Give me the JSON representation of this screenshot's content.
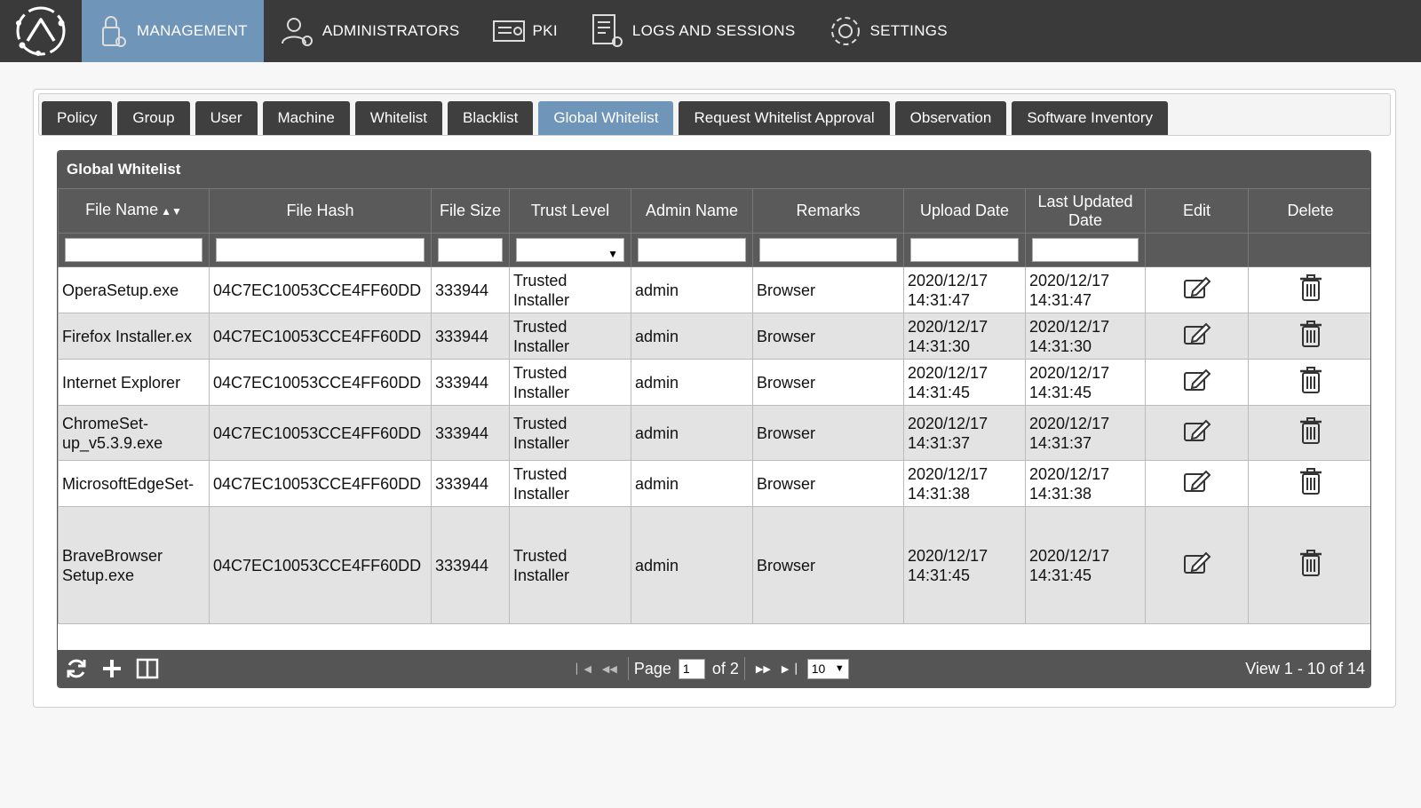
{
  "nav": {
    "items": [
      {
        "label": "MANAGEMENT",
        "icon": "lock-gear-icon",
        "active": true
      },
      {
        "label": "ADMINISTRATORS",
        "icon": "user-gear-icon",
        "active": false
      },
      {
        "label": "PKI",
        "icon": "certificate-icon",
        "active": false
      },
      {
        "label": "LOGS AND SESSIONS",
        "icon": "log-gear-icon",
        "active": false
      },
      {
        "label": "SETTINGS",
        "icon": "gear-icon",
        "active": false
      }
    ]
  },
  "tabs": [
    "Policy",
    "Group",
    "User",
    "Machine",
    "Whitelist",
    "Blacklist",
    "Global Whitelist",
    "Request Whitelist Approval",
    "Observation",
    "Software Inventory"
  ],
  "active_tab": "Global Whitelist",
  "grid": {
    "title": "Global Whitelist",
    "columns": [
      "File Name",
      "File Hash",
      "File Size",
      "Trust Level",
      "Admin Name",
      "Remarks",
      "Upload Date",
      "Last Updated Date",
      "Edit",
      "Delete"
    ],
    "rows": [
      {
        "file_name": "OperaSetup.exe",
        "file_hash": "04C7EC10053CCE4FF60DD",
        "file_size": "333944",
        "trust_level": "Trusted Installer",
        "admin_name": "admin",
        "remarks": "Browser",
        "upload_date": "2020/12/17 14:31:47",
        "last_updated": "2020/12/17 14:31:47"
      },
      {
        "file_name": "Firefox Installer.ex",
        "file_hash": "04C7EC10053CCE4FF60DD",
        "file_size": "333944",
        "trust_level": "Trusted Installer",
        "admin_name": "admin",
        "remarks": "Browser",
        "upload_date": "2020/12/17 14:31:30",
        "last_updated": "2020/12/17 14:31:30"
      },
      {
        "file_name": "Internet Explorer",
        "file_hash": "04C7EC10053CCE4FF60DD",
        "file_size": "333944",
        "trust_level": "Trusted Installer",
        "admin_name": "admin",
        "remarks": "Browser",
        "upload_date": "2020/12/17 14:31:45",
        "last_updated": "2020/12/17 14:31:45"
      },
      {
        "file_name": "ChromeSet-up_v5.3.9.exe",
        "file_hash": "04C7EC10053CCE4FF60DD",
        "file_size": "333944",
        "trust_level": "Trusted Installer",
        "admin_name": "admin",
        "remarks": "Browser",
        "upload_date": "2020/12/17 14:31:37",
        "last_updated": "2020/12/17 14:31:37"
      },
      {
        "file_name": "MicrosoftEdgeSet-",
        "file_hash": "04C7EC10053CCE4FF60DD",
        "file_size": "333944",
        "trust_level": "Trusted Installer",
        "admin_name": "admin",
        "remarks": "Browser",
        "upload_date": "2020/12/17 14:31:38",
        "last_updated": "2020/12/17 14:31:38"
      },
      {
        "file_name": "BraveBrowser Setup.exe",
        "file_hash": "04C7EC10053CCE4FF60DD",
        "file_size": "333944",
        "trust_level": "Trusted Installer",
        "admin_name": "admin",
        "remarks": "Browser",
        "upload_date": "2020/12/17 14:31:45",
        "last_updated": "2020/12/17 14:31:45"
      }
    ]
  },
  "pager": {
    "page_label": "Page",
    "page_value": "1",
    "of_label": "of 2",
    "rows_per_page": "10",
    "view_info": "View 1 - 10 of 14"
  },
  "colors": {
    "nav_bg": "#3a3a3a",
    "accent": "#6f95b8",
    "grid_header": "#5a5a5a"
  }
}
